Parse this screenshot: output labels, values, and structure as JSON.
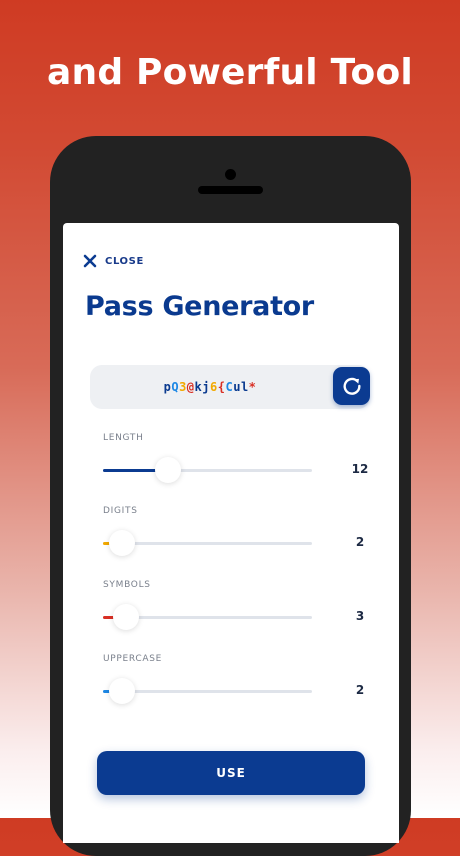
{
  "headline": "and Powerful Tool",
  "close": {
    "label": "CLOSE",
    "icon": "close-icon"
  },
  "title": "Pass Generator",
  "password": {
    "chars": [
      {
        "c": "p",
        "color": "#0a3a8f"
      },
      {
        "c": "Q",
        "color": "#1e88e5"
      },
      {
        "c": "3",
        "color": "#f2a900"
      },
      {
        "c": "@",
        "color": "#d93025"
      },
      {
        "c": "k",
        "color": "#0a3a8f"
      },
      {
        "c": "j",
        "color": "#0a3a8f"
      },
      {
        "c": "6",
        "color": "#f2a900"
      },
      {
        "c": "{",
        "color": "#d93025"
      },
      {
        "c": "C",
        "color": "#1e88e5"
      },
      {
        "c": "u",
        "color": "#0a3a8f"
      },
      {
        "c": "l",
        "color": "#0a3a8f"
      },
      {
        "c": "*",
        "color": "#d93025"
      }
    ],
    "refresh_icon": "refresh-icon"
  },
  "sliders": [
    {
      "key": "length",
      "label": "LENGTH",
      "value": "12",
      "fraction": 0.31,
      "color": "#0b3b91"
    },
    {
      "key": "digits",
      "label": "DIGITS",
      "value": "2",
      "fraction": 0.09,
      "color": "#f2a900"
    },
    {
      "key": "symbols",
      "label": "SYMBOLS",
      "value": "3",
      "fraction": 0.11,
      "color": "#d93025"
    },
    {
      "key": "uppercase",
      "label": "UPPERCASE",
      "value": "2",
      "fraction": 0.09,
      "color": "#1e88e5"
    }
  ],
  "use_button": "USE",
  "colors": {
    "primary": "#0b3b91",
    "accent_red": "#cf3b23"
  }
}
